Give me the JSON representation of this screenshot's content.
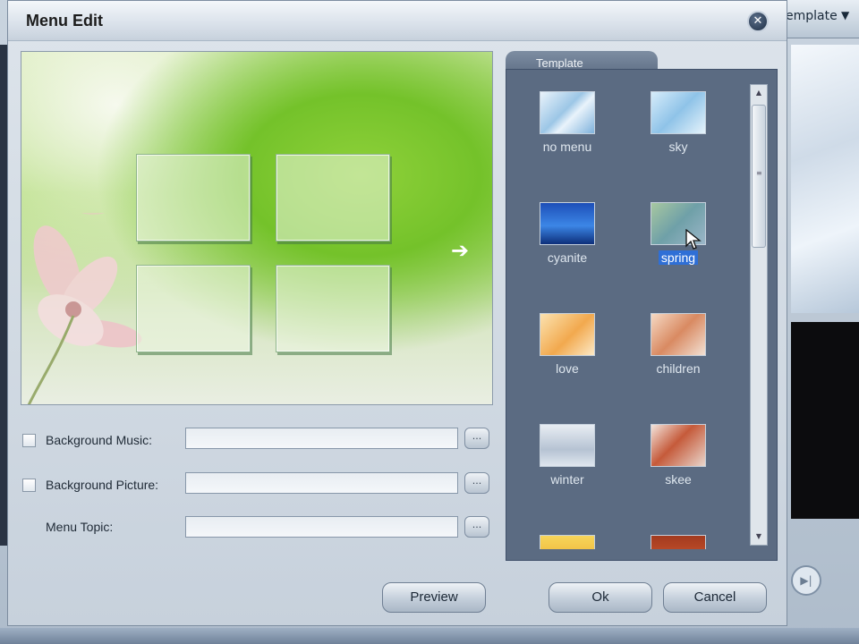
{
  "background_app": {
    "template_menu_label": "emplate",
    "template_menu_arrow": "▼"
  },
  "dialog": {
    "title": "Menu Edit",
    "close_glyph": "✕"
  },
  "preview": {
    "arrow_glyph": "➔"
  },
  "form": {
    "background_music": {
      "label": "Background Music:",
      "value": "",
      "browse_label": "..."
    },
    "background_picture": {
      "label": "Background Picture:",
      "value": "",
      "browse_label": "..."
    },
    "menu_topic": {
      "label": "Menu Topic:",
      "value": "",
      "browse_label": "..."
    }
  },
  "template_panel": {
    "tab_label": "Template",
    "selected": "spring",
    "items": [
      {
        "name": "no menu",
        "icon": "template-no-menu-thumbnail"
      },
      {
        "name": "sky",
        "icon": "template-sky-thumbnail"
      },
      {
        "name": "cyanite",
        "icon": "template-cyanite-thumbnail"
      },
      {
        "name": "spring",
        "icon": "template-spring-thumbnail"
      },
      {
        "name": "love",
        "icon": "template-love-thumbnail"
      },
      {
        "name": "children",
        "icon": "template-children-thumbnail"
      },
      {
        "name": "winter",
        "icon": "template-winter-thumbnail"
      },
      {
        "name": "skee",
        "icon": "template-skee-thumbnail"
      },
      {
        "name": "",
        "icon": "template-partial-thumbnail-1"
      },
      {
        "name": "",
        "icon": "template-partial-thumbnail-2"
      }
    ]
  },
  "buttons": {
    "preview": "Preview",
    "ok": "Ok",
    "cancel": "Cancel"
  },
  "colors": {
    "selection_highlight": "#2f6fd6",
    "panel_background": "#5b6b82"
  }
}
